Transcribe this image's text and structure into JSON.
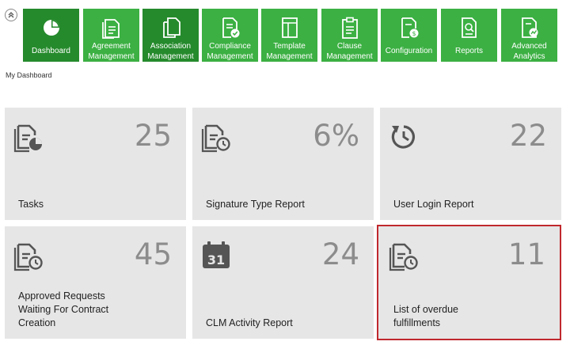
{
  "nav": {
    "items": [
      {
        "label": "Dashboard",
        "icon": "pie-chart-icon"
      },
      {
        "label": "Agreement\nManagement",
        "icon": "agreement-document-icon"
      },
      {
        "label": "Association\nManagement",
        "icon": "association-documents-icon"
      },
      {
        "label": "Compliance\nManagement",
        "icon": "compliance-check-icon"
      },
      {
        "label": "Template\nManagement",
        "icon": "template-icon"
      },
      {
        "label": "Clause\nManagement",
        "icon": "clause-clipboard-icon"
      },
      {
        "label": "Configuration",
        "icon": "configuration-document-icon"
      },
      {
        "label": "Reports",
        "icon": "reports-search-icon"
      },
      {
        "label": "Advanced\nAnalytics",
        "icon": "analytics-chart-icon"
      }
    ],
    "active_index": 0,
    "colors": {
      "tile": "#3cb043",
      "active": "#258a2c"
    }
  },
  "page": {
    "title": "My Dashboard"
  },
  "tiles": [
    {
      "label": "Tasks",
      "value": "25",
      "icon": "document-chart-icon"
    },
    {
      "label": "Signature Type Report",
      "value": "6%",
      "icon": "document-clock-icon"
    },
    {
      "label": "User Login Report",
      "value": "22",
      "icon": "history-clock-icon"
    },
    {
      "label": "Approved Requests\nWaiting For Contract\nCreation",
      "value": "45",
      "icon": "document-clock-icon"
    },
    {
      "label": "CLM Activity Report",
      "value": "24",
      "icon": "calendar-icon"
    },
    {
      "label": "List of overdue\nfulfillments",
      "value": "11",
      "icon": "document-clock-icon"
    }
  ],
  "calendar_day": "31",
  "highlight_color": "#c0282d"
}
